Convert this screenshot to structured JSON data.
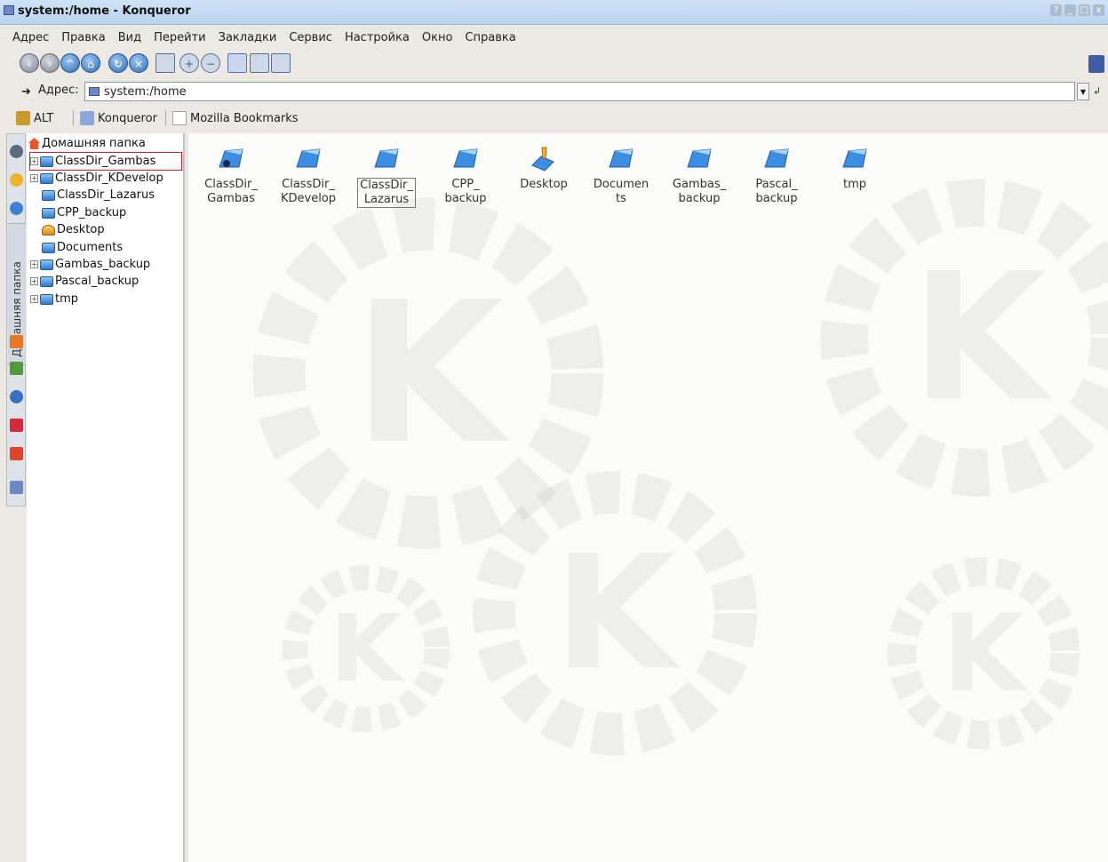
{
  "titlebar": {
    "title": "system:/home - Konqueror",
    "buttons": [
      "?",
      "_",
      "□",
      "x"
    ]
  },
  "menu": [
    "Адрес",
    "Правка",
    "Вид",
    "Перейти",
    "Закладки",
    "Сервис",
    "Настройка",
    "Окно",
    "Справка"
  ],
  "toolbar": {
    "buttons": [
      "back-icon",
      "forward-icon",
      "up-icon",
      "home-icon",
      "reload-icon",
      "stop-icon",
      "print-icon",
      "zoom-in-icon",
      "zoom-out-icon",
      "icon-view-icon",
      "list-view-icon",
      "preview-icon"
    ]
  },
  "location": {
    "label": "Адрес:",
    "value": "system:/home"
  },
  "bookmarks": {
    "items": [
      "ALT",
      "Konqueror",
      "Mozilla Bookmarks"
    ]
  },
  "sidebar": {
    "tab_label": "Домашняя папка"
  },
  "tree": {
    "root": "Домашняя папка",
    "items": [
      {
        "label": "ClassDir_Gambas",
        "expandable": true,
        "selected": true
      },
      {
        "label": "ClassDir_KDevelop",
        "expandable": true
      },
      {
        "label": "ClassDir_Lazarus",
        "expandable": false
      },
      {
        "label": "CPP_backup",
        "expandable": false
      },
      {
        "label": "Desktop",
        "expandable": false
      },
      {
        "label": "Documents",
        "expandable": false
      },
      {
        "label": "Gambas_backup",
        "expandable": true
      },
      {
        "label": "Pascal_backup",
        "expandable": true
      },
      {
        "label": "tmp",
        "expandable": true
      }
    ]
  },
  "files": [
    {
      "line1": "ClassDir_",
      "line2": "Gambas"
    },
    {
      "line1": "ClassDir_",
      "line2": "KDevelop"
    },
    {
      "line1": "ClassDir_",
      "line2": "Lazarus",
      "selected": true
    },
    {
      "line1": "CPP_",
      "line2": "backup"
    },
    {
      "line1": "Desktop",
      "line2": ""
    },
    {
      "line1": "Documen",
      "line2": "ts"
    },
    {
      "line1": "Gambas_",
      "line2": "backup"
    },
    {
      "line1": "Pascal_",
      "line2": "backup"
    },
    {
      "line1": "tmp",
      "line2": ""
    }
  ],
  "colors": {
    "folder": "#3c8fe0",
    "selection_outline": "#d2232a",
    "titlebar": "#c4dcf2"
  }
}
